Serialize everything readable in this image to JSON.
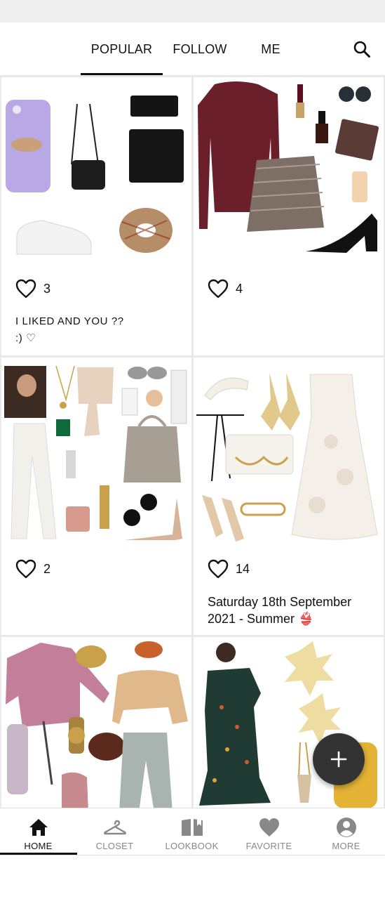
{
  "top_tabs": {
    "popular": "POPULAR",
    "follow": "FOLLOW",
    "me": "ME"
  },
  "posts": [
    {
      "likes": "3",
      "caption_line1": "I LIKED AND YOU ??",
      "caption_line2": ":) ♡"
    },
    {
      "likes": "4"
    },
    {
      "likes": "2"
    },
    {
      "likes": "14",
      "caption_line1": "Saturday 18th September",
      "caption_line2": "2021 - Summer 👙"
    },
    {},
    {}
  ],
  "bottom_nav": {
    "home": "HOME",
    "closet": "CLOSET",
    "lookbook": "LOOKBOOK",
    "favorite": "FAVORITE",
    "more": "MORE"
  },
  "colors": {
    "accent": "#111111",
    "inactive": "#888888",
    "fab": "#333333",
    "divider": "#e9e9e9"
  },
  "icons": {
    "search": "search-icon",
    "like": "heart-outline-icon",
    "add": "plus-icon",
    "home": "home-icon",
    "closet": "hanger-icon",
    "lookbook": "book-icon",
    "favorite": "heart-icon",
    "more": "account-icon"
  }
}
